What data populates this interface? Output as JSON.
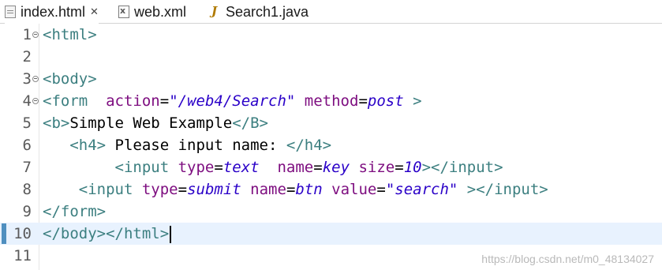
{
  "tabs": [
    {
      "label": "index.html",
      "icon": "html-file-icon",
      "close": "✕",
      "active": true
    },
    {
      "label": "web.xml",
      "icon": "xml-file-icon",
      "active": false
    },
    {
      "label": "Search1.java",
      "icon": "java-file-icon",
      "active": false
    }
  ],
  "editor": {
    "line_numbers": [
      "1",
      "2",
      "3",
      "4",
      "5",
      "6",
      "7",
      "8",
      "9",
      "10",
      "11"
    ],
    "current_line": "10",
    "code": {
      "l1": {
        "open": "<html>"
      },
      "l3": {
        "open": "<body>"
      },
      "l4": {
        "tag": "<form",
        "attr1": "action",
        "eq1": "=",
        "val1": "\"/web4/Search\"",
        "attr2": "method",
        "eq2": "=",
        "val2": "post",
        "close": " >"
      },
      "l5": {
        "tag_open": "<b>",
        "text": "Simple Web Example",
        "tag_close": "</B>"
      },
      "l6": {
        "indent": "   ",
        "tag_open": "<h4>",
        "text": " Please input name: ",
        "tag_close": "</h4>"
      },
      "l7": {
        "indent": "        ",
        "tag": "<input",
        "attr1": "type",
        "eq1": "=",
        "val1": "text",
        "attr2": "name",
        "eq2": "=",
        "val2": "key",
        "attr3": "size",
        "eq3": "=",
        "val3": "10",
        "close": "></input>"
      },
      "l8": {
        "indent": "    ",
        "tag": "<input",
        "attr1": "type",
        "eq1": "=",
        "val1": "submit",
        "attr2": "name",
        "eq2": "=",
        "val2": "btn",
        "attr3": "value",
        "eq3": "=",
        "val3": "\"search\"",
        "close": " ></input>"
      },
      "l9": {
        "close": "</form>"
      },
      "l10": {
        "close1": "</body>",
        "close2": "</html>"
      }
    }
  },
  "watermark": "https://blog.csdn.net/m0_48134027",
  "colors": {
    "tag": "#3c7f80",
    "attribute": "#7e0e80",
    "value": "#2a00c8",
    "current_line": "#e8f2fe"
  }
}
